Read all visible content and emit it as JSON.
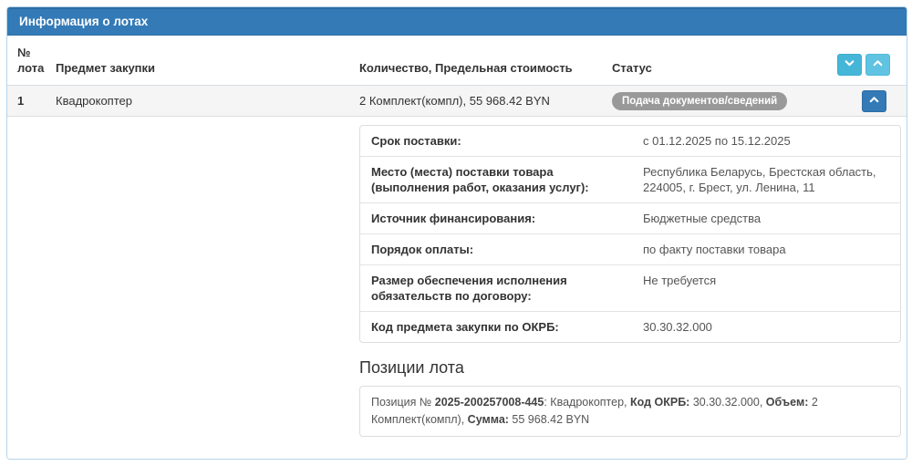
{
  "panel": {
    "title": "Информация о лотах",
    "table": {
      "headers": {
        "lot_number": "№ лота",
        "subject": "Предмет закупки",
        "quantity_cost": "Количество, Предельная стоимость",
        "status": "Статус"
      },
      "rows": [
        {
          "lot_number": "1",
          "subject": "Квадрокоптер",
          "quantity_cost": "2 Комплект(компл), 55 968.42 BYN",
          "status": "Подача документов/сведений"
        }
      ]
    },
    "details": {
      "rows": [
        {
          "label": "Срок поставки:",
          "value": "с 01.12.2025 по 15.12.2025"
        },
        {
          "label": "Место (места) поставки товара (выполнения работ, оказания услуг):",
          "value": "Республика Беларусь, Брестская область, 224005, г. Брест, ул. Ленина, 11"
        },
        {
          "label": "Источник финансирования:",
          "value": "Бюджетные средства"
        },
        {
          "label": "Порядок оплаты:",
          "value": "по факту поставки товара"
        },
        {
          "label": "Размер обеспечения исполнения обязательств по договору:",
          "value": "Не требуется"
        },
        {
          "label": "Код предмета закупки по ОКРБ:",
          "value": "30.30.32.000"
        }
      ]
    },
    "positions": {
      "heading": "Позиции лота",
      "item": {
        "prefix": "Позиция № ",
        "number": "2025-200257008-445",
        "after_number": ": Квадрокоптер, ",
        "okrb_label": "Код ОКРБ:",
        "okrb_value": " 30.30.32.000, ",
        "volume_label": "Объем:",
        "volume_value": " 2 Комплект(компл), ",
        "sum_label": "Сумма:",
        "sum_value": " 55 968.42 BYN"
      }
    },
    "icons": {
      "collapse_all": "chevron-down-icon",
      "expand_all": "chevron-up-icon",
      "row_toggle": "chevron-up-icon"
    },
    "colors": {
      "header_bg": "#337ab7",
      "panel_border": "#b6d4ea",
      "accent_cyan": "#5bc0de",
      "button_blue": "#337ab7",
      "badge_bg": "#999999",
      "row_bg": "#f5f5f5"
    }
  }
}
